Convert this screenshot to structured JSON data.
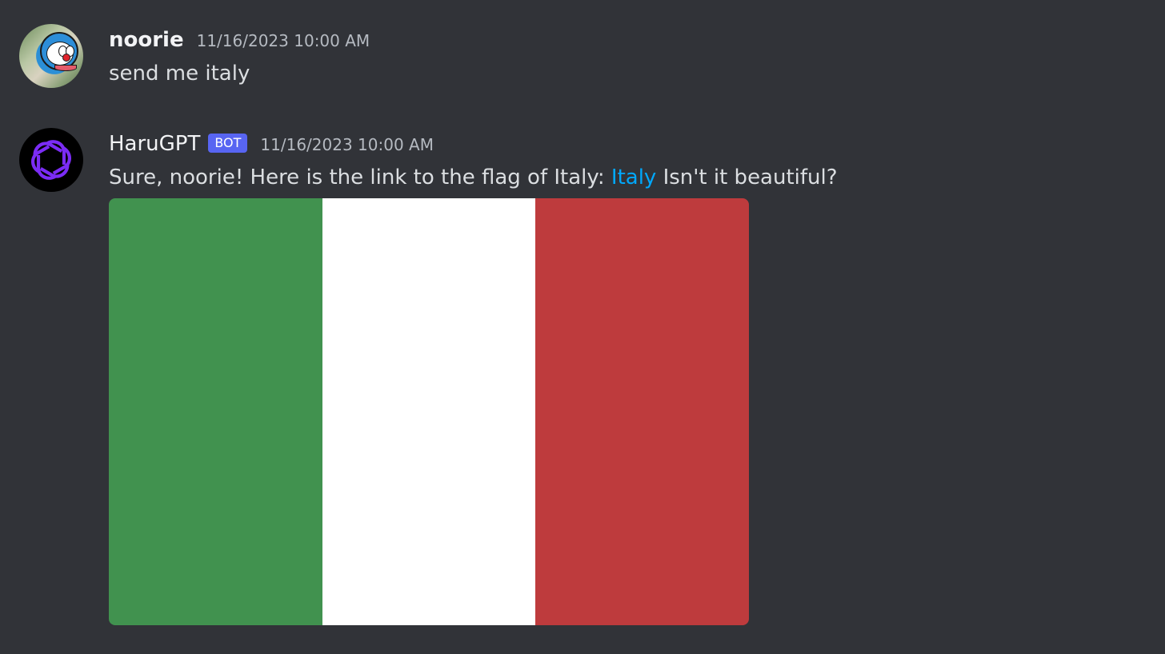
{
  "messages": [
    {
      "username": "noorie",
      "timestamp": "11/16/2023 10:00 AM",
      "text": "send me italy",
      "avatar_icon": "doraemon-avatar-icon"
    },
    {
      "username": "HaruGPT",
      "badge": "BOT",
      "timestamp": "11/16/2023 10:00 AM",
      "text_before": "Sure, noorie! Here is the link to the flag of Italy: ",
      "link_text": "Italy",
      "text_after": " Isn't it beautiful?",
      "avatar_icon": "openai-logo-icon",
      "image": {
        "icon": "italy-flag-icon",
        "colors": [
          "#41924f",
          "#ffffff",
          "#be3b3d"
        ]
      }
    }
  ],
  "colors": {
    "background": "#313338",
    "link": "#00a8fc",
    "badge": "#5865f2",
    "bot_logo": "#7b2cf5"
  }
}
